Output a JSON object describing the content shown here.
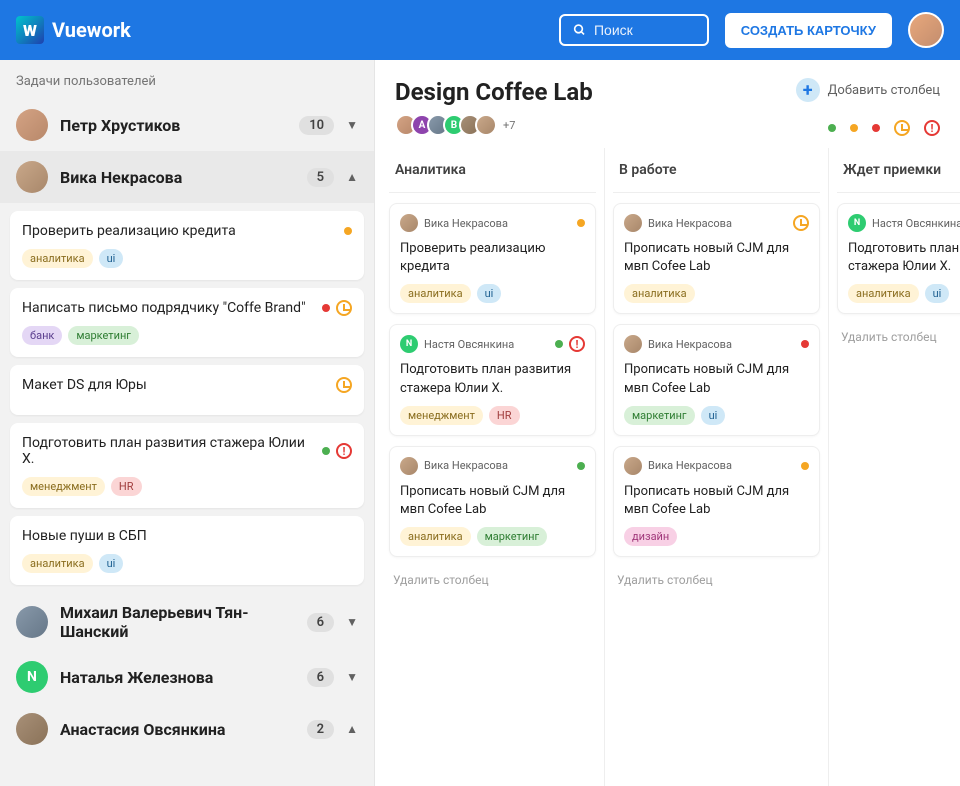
{
  "header": {
    "brand": "Vuework",
    "search_placeholder": "Поиск",
    "create_label": "СОЗДАТЬ КАРТОЧКУ"
  },
  "sidebar": {
    "title": "Задачи пользователей",
    "users": [
      {
        "name": "Петр Хрустиков",
        "count": "10",
        "expanded": false
      },
      {
        "name": "Вика Некрасова",
        "count": "5",
        "expanded": true
      },
      {
        "name": "Михаил Валерьевич Тян-Шанский",
        "count": "6",
        "expanded": false
      },
      {
        "name": "Наталья Железнова",
        "count": "6",
        "expanded": false
      },
      {
        "name": "Анастасия Овсянкина",
        "count": "2",
        "expanded": true
      }
    ],
    "tasks": [
      {
        "title": "Проверить реализацию кредита",
        "tags": [
          {
            "label": "аналитика",
            "cls": "yellow"
          },
          {
            "label": "ui",
            "cls": "blue"
          }
        ],
        "status": [
          "orange"
        ]
      },
      {
        "title": "Написать письмо подрядчику \"Coffe Brand\"",
        "tags": [
          {
            "label": "банк",
            "cls": "purple"
          },
          {
            "label": "маркетинг",
            "cls": "green"
          }
        ],
        "status": [
          "red",
          "clock"
        ]
      },
      {
        "title": "Макет DS для Юры",
        "tags": [],
        "status": [
          "clock"
        ]
      },
      {
        "title": "Подготовить план развития стажера Юлии Х.",
        "tags": [
          {
            "label": "менеджмент",
            "cls": "yellow"
          },
          {
            "label": "HR",
            "cls": "pink"
          }
        ],
        "status": [
          "green",
          "alert"
        ]
      },
      {
        "title": "Новые пуши в СБП",
        "tags": [
          {
            "label": "аналитика",
            "cls": "yellow"
          },
          {
            "label": "ui",
            "cls": "blue"
          }
        ],
        "status": []
      }
    ]
  },
  "board": {
    "title": "Design Coffee Lab",
    "members_more": "+7",
    "add_column_label": "Добавить столбец",
    "delete_column_label": "Удалить столбец",
    "columns": [
      {
        "title": "Аналитика",
        "cards": [
          {
            "assignee": "Вика Некрасова",
            "ava": "p2",
            "title": "Проверить реализацию кредита",
            "tags": [
              {
                "label": "аналитика",
                "cls": "yellow"
              },
              {
                "label": "ui",
                "cls": "blue"
              }
            ],
            "status": [
              "orange"
            ]
          },
          {
            "assignee": "Настя Овсянкина",
            "ava": "n",
            "title": "Подготовить план развития стажера Юлии Х.",
            "tags": [
              {
                "label": "менеджмент",
                "cls": "yellow"
              },
              {
                "label": "HR",
                "cls": "pink"
              }
            ],
            "status": [
              "green",
              "alert"
            ]
          },
          {
            "assignee": "Вика Некрасова",
            "ava": "p2",
            "title": "Прописать новый CJM для мвп Cofee Lab",
            "tags": [
              {
                "label": "аналитика",
                "cls": "yellow"
              },
              {
                "label": "маркетинг",
                "cls": "green"
              }
            ],
            "status": [
              "green"
            ]
          }
        ]
      },
      {
        "title": "В работе",
        "cards": [
          {
            "assignee": "Вика Некрасова",
            "ava": "p2",
            "title": "Прописать новый CJM для мвп Cofee Lab",
            "tags": [
              {
                "label": "аналитика",
                "cls": "yellow"
              }
            ],
            "status": [
              "clock"
            ]
          },
          {
            "assignee": "Вика Некрасова",
            "ava": "p2",
            "title": "Прописать новый CJM для мвп Cofee Lab",
            "tags": [
              {
                "label": "маркетинг",
                "cls": "green"
              },
              {
                "label": "ui",
                "cls": "blue"
              }
            ],
            "status": [
              "red"
            ]
          },
          {
            "assignee": "Вика Некрасова",
            "ava": "p2",
            "title": "Прописать новый CJM для мвп Cofee Lab",
            "tags": [
              {
                "label": "дизайн",
                "cls": "magenta"
              }
            ],
            "status": [
              "orange"
            ]
          }
        ]
      },
      {
        "title": "Ждет приемки",
        "cards": [
          {
            "assignee": "Настя Овсянкина",
            "ava": "n",
            "title": "Подготовить план развития стажера Юлии Х.",
            "tags": [
              {
                "label": "аналитика",
                "cls": "yellow"
              },
              {
                "label": "ui",
                "cls": "blue"
              }
            ],
            "status": []
          }
        ]
      }
    ]
  }
}
